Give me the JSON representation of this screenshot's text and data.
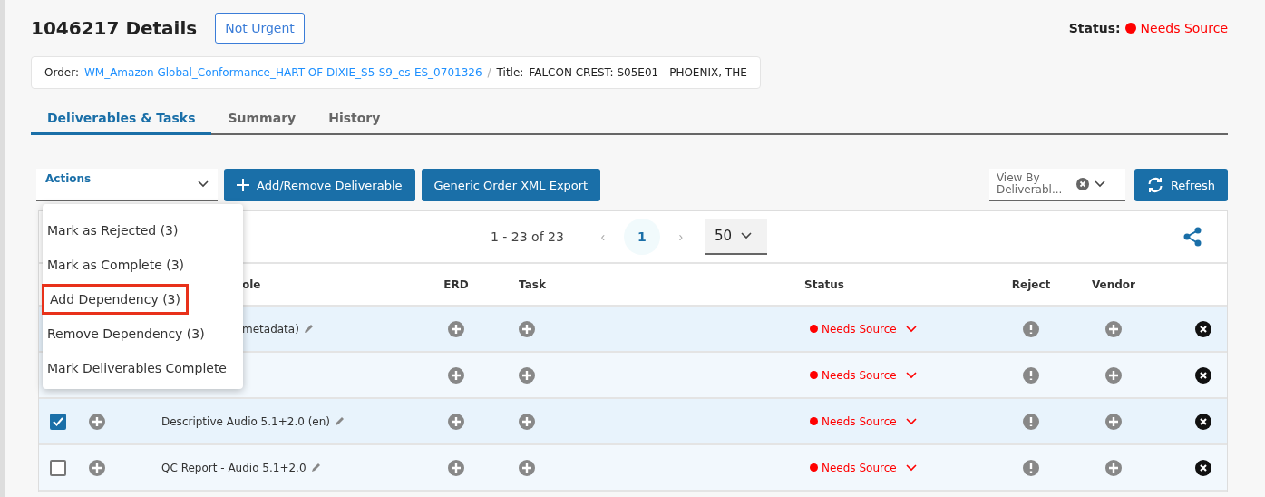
{
  "header": {
    "title": "1046217 Details",
    "priority_button": "Not Urgent",
    "status_label": "Status:",
    "status_value": "Needs Source"
  },
  "breadcrumb": {
    "order_label": "Order:",
    "order_link": "WM_Amazon Global_Conformance_HART OF DIXIE_S5-S9_es-ES_0701326",
    "separator": "/",
    "title_label": "Title:",
    "title_value": "FALCON CREST: S05E01 - PHOENIX, THE"
  },
  "tabs": [
    {
      "label": "Deliverables & Tasks",
      "selected": true
    },
    {
      "label": "Summary",
      "selected": false
    },
    {
      "label": "History",
      "selected": false
    }
  ],
  "toolbar": {
    "actions_label": "Actions",
    "add_button": "Add/Remove Deliverable",
    "export_button": "Generic Order XML Export",
    "view_by": "View By Deliverabl...",
    "refresh_button": "Refresh"
  },
  "actions_menu": [
    {
      "label": "Mark as Rejected (3)",
      "highlighted": false
    },
    {
      "label": "Mark as Complete (3)",
      "highlighted": false
    },
    {
      "label": "Add Dependency (3)",
      "highlighted": true
    },
    {
      "label": "Remove Dependency (3)",
      "highlighted": false
    },
    {
      "label": "Mark Deliverables Complete",
      "highlighted": false
    }
  ],
  "pagination": {
    "range": "1 - 23 of 23",
    "prev": "‹",
    "page": "1",
    "next": "›",
    "page_size": "50"
  },
  "table": {
    "columns": [
      {
        "label": "ole",
        "partly_hidden": true
      },
      {
        "label": "ERD"
      },
      {
        "label": "Task"
      },
      {
        "label": "Status"
      },
      {
        "label": "Reject"
      },
      {
        "label": "Vendor"
      }
    ],
    "rows": [
      {
        "title": "metadata)",
        "partly_hidden": true,
        "status": "Needs Source"
      },
      {
        "status": "Needs Source"
      },
      {
        "checked": true,
        "title": "Descriptive Audio 5.1+2.0 (en)",
        "status": "Needs Source"
      },
      {
        "checked": false,
        "title": "QC Report - Audio 5.1+2.0",
        "status": "Needs Source"
      }
    ]
  }
}
